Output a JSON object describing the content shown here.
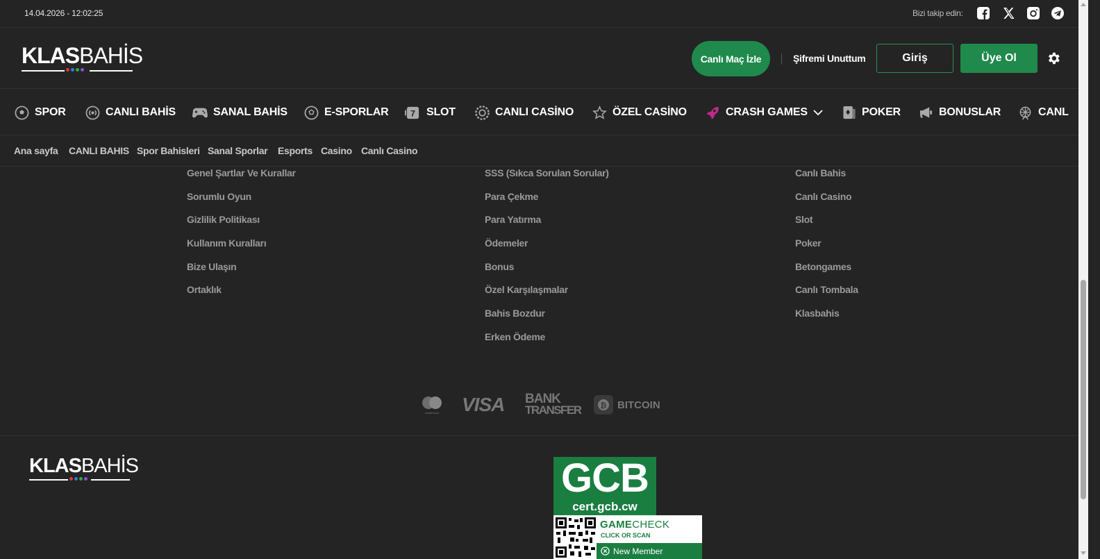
{
  "topbar": {
    "datetime": "14.04.2026 - 12:02:25",
    "follow_label": "Bizi takip edin:",
    "socials": [
      "facebook-icon",
      "x-icon",
      "instagram-icon",
      "telegram-icon"
    ]
  },
  "header": {
    "logo_bold": "KLAS",
    "logo_light": "BAHİS",
    "logo_dot_colors": [
      "#d93a3a",
      "#2f7fd8",
      "#2fa84f",
      "#8a4fcf"
    ],
    "live_match_label": "Canlı Maç İzle",
    "forgot_label": "Şifremi Unuttum",
    "login_label": "Giriş",
    "register_label": "Üye Ol"
  },
  "mainnav": {
    "items": [
      {
        "label": "SPOR",
        "icon": "soccer-ball-icon"
      },
      {
        "label": "CANLI BAHİS",
        "icon": "live-broadcast-icon"
      },
      {
        "label": "SANAL BAHİS",
        "icon": "gamepad-icon"
      },
      {
        "label": "E-SPORLAR",
        "icon": "esports-icon"
      },
      {
        "label": "SLOT",
        "icon": "slot-machine-icon"
      },
      {
        "label": "CANLI CASİNO",
        "icon": "casino-chip-icon"
      },
      {
        "label": "ÖZEL CASİNO",
        "icon": "star-icon"
      },
      {
        "label": "CRASH GAMES",
        "icon": "rocket-icon"
      },
      {
        "label": "POKER",
        "icon": "playing-card-icon"
      },
      {
        "label": "BONUSLAR",
        "icon": "megaphone-icon"
      },
      {
        "label": "CANL",
        "icon": "ferris-wheel-icon"
      }
    ]
  },
  "subnav": {
    "items": [
      "Ana sayfa",
      "CANLI BAHIS",
      "Spor Bahisleri",
      "Sanal Sporlar",
      "Esports",
      "Casino",
      "Canlı Casino"
    ]
  },
  "footer": {
    "col1": [
      "Genel Şartlar Ve Kurallar",
      "Sorumlu Oyun",
      "Gizlilik Politikası",
      "Kullanım Kuralları",
      "Bize Ulaşın",
      "Ortaklık"
    ],
    "col2": [
      "SSS (Sıkca Sorulan Sorular)",
      "Para Çekme",
      "Para Yatırma",
      "Ödemeler",
      "Bonus",
      "Özel Karşılaşmalar",
      "Bahis Bozdur",
      "Erken Ödeme"
    ],
    "col3": [
      "Canlı Bahis",
      "Canlı Casino",
      "Slot",
      "Poker",
      "Betongames",
      "Canlı Tombala",
      "Klasbahis"
    ],
    "payments": {
      "mastercard_label": "mastercard",
      "visa_label": "VISA",
      "bank_line1": "BANK",
      "bank_line2": "TRANSFER",
      "bitcoin_label": "BITCOIN"
    },
    "gcb_big": "GCB",
    "gcb_small": "cert.gcb.cw",
    "gamecheck_bold": "GAME",
    "gamecheck_light": "CHECK",
    "gamecheck_sub": "CLICK OR SCAN",
    "gamecheck_member": "New Member"
  },
  "colors": {
    "accent": "#1f8a4c",
    "background": "#242424",
    "crash_icon": "#c2298a"
  }
}
